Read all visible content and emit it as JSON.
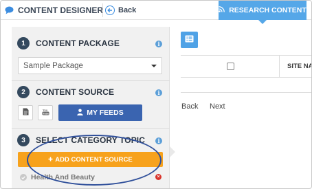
{
  "topbar": {
    "app_title": "CONTENT DESIGNER",
    "back_label": "Back",
    "research_label": "RESEARCH CONTENT"
  },
  "sidebar": {
    "sections": [
      {
        "number": "1",
        "title": "CONTENT PACKAGE"
      },
      {
        "number": "2",
        "title": "CONTENT SOURCE"
      },
      {
        "number": "3",
        "title": "SELECT CATEGORY TOPIC"
      }
    ],
    "package_select": {
      "selected": "Sample Package"
    },
    "my_feeds_label": "MY FEEDS",
    "add_source_label": "ADD CONTENT SOURCE",
    "topics": [
      {
        "label": "Health And Beauty"
      }
    ]
  },
  "main": {
    "table": {
      "columns": [
        "",
        "SITE NA"
      ]
    },
    "pager": {
      "back_label": "Back",
      "next_label": "Next"
    }
  },
  "colors": {
    "primary_blue": "#55a7e8",
    "feeds_button": "#3a64b0",
    "add_source_orange": "#f7a21c",
    "step_badge": "#34495e",
    "highlight_ring": "#2f4f9a",
    "remove_red": "#d9342b"
  },
  "icons": [
    "chat-icon",
    "back-arrow-icon",
    "rss-icon",
    "info-icon",
    "file-icon",
    "youtube-icon",
    "user-icon",
    "plus-icon",
    "check-icon",
    "remove-icon",
    "list-icon"
  ]
}
